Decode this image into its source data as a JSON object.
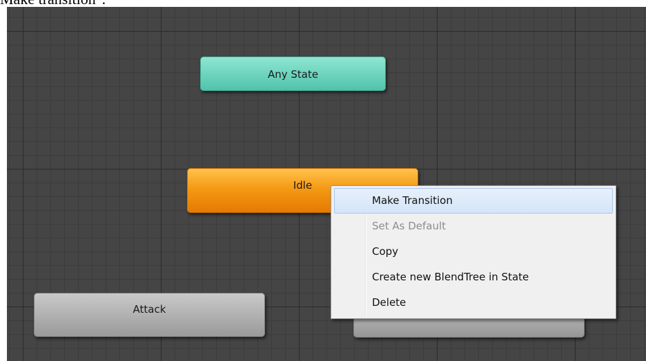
{
  "caption": "Make transition\".",
  "states": {
    "any_state": "Any State",
    "idle": "Idle",
    "attack": "Attack"
  },
  "context_menu": {
    "items": [
      {
        "label": "Make Transition",
        "highlighted": true,
        "enabled": true
      },
      {
        "label": "Set As Default",
        "highlighted": false,
        "enabled": false
      },
      {
        "label": "Copy",
        "highlighted": false,
        "enabled": true
      },
      {
        "label": "Create new BlendTree in State",
        "highlighted": false,
        "enabled": true
      },
      {
        "label": "Delete",
        "highlighted": false,
        "enabled": true
      }
    ]
  },
  "colors": {
    "grid_background": "#454545",
    "any_state": "#6fd6c0",
    "idle_default_state": "#f08a0b",
    "regular_state": "#aaaaaa",
    "menu_highlight": "#d4e5f8"
  }
}
